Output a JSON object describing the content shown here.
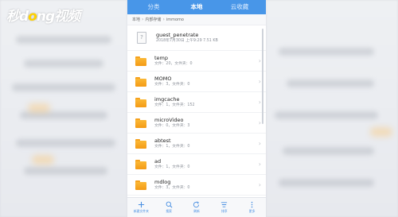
{
  "watermark": {
    "part1": "秒",
    "part2": "d",
    "part3": "o",
    "part4": "ng",
    "part5": "视频"
  },
  "tabs": [
    {
      "label": "分类"
    },
    {
      "label": "本地"
    },
    {
      "label": "云收藏"
    }
  ],
  "breadcrumb": [
    "本地",
    "内部存储",
    "immomo"
  ],
  "files": [
    {
      "type": "file",
      "name": "guest_penetrate",
      "meta": "2018年7月30日 上午9:29 7.51 KB"
    },
    {
      "type": "folder",
      "name": "temp",
      "meta": "文件：20，文件夹：0"
    },
    {
      "type": "folder",
      "name": "MOMO",
      "meta": "文件：3，文件夹：0"
    },
    {
      "type": "folder",
      "name": "imgcache",
      "meta": "文件：1，文件夹：152"
    },
    {
      "type": "folder",
      "name": "microVideo",
      "meta": "文件：0，文件夹：3"
    },
    {
      "type": "folder",
      "name": "abtest",
      "meta": "文件：1，文件夹：0"
    },
    {
      "type": "folder",
      "name": "ad",
      "meta": "文件：1，文件夹：0"
    },
    {
      "type": "folder",
      "name": "mdlog",
      "meta": "文件：3，文件夹：0"
    }
  ],
  "toolbar": [
    {
      "label": "新建文件夹",
      "icon": "plus-icon"
    },
    {
      "label": "搜索",
      "icon": "search-icon"
    },
    {
      "label": "刷新",
      "icon": "refresh-icon"
    },
    {
      "label": "排序",
      "icon": "sort-icon"
    },
    {
      "label": "更多",
      "icon": "more-icon"
    }
  ],
  "colors": {
    "tabbar": "#4896e8",
    "folder": "#f6a21e",
    "toolbar_accent": "#4a90e2"
  }
}
